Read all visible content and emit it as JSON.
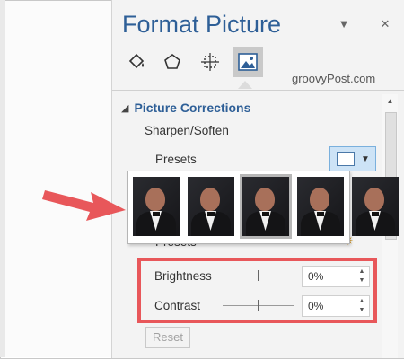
{
  "pane": {
    "title": "Format Picture"
  },
  "icons": {
    "tab1": "fill-bucket-icon",
    "tab2": "pentagon-icon",
    "tab3": "size-icon",
    "tab4": "picture-icon"
  },
  "watermark": "groovyPost.com",
  "section": {
    "label": "Picture Corrections"
  },
  "sharpen": {
    "heading": "Sharpen/Soften",
    "presets_label": "Presets"
  },
  "color": {
    "presets_label": "Presets"
  },
  "brightness": {
    "label": "Brightness",
    "value": "0%",
    "level": 0.5
  },
  "contrast": {
    "label": "Contrast",
    "value": "0%",
    "level": 0.5
  },
  "reset": {
    "label": "Reset"
  },
  "colors": {
    "title": "#2e5f97",
    "highlight": "#e8575a",
    "arrow": "#e8575a"
  }
}
